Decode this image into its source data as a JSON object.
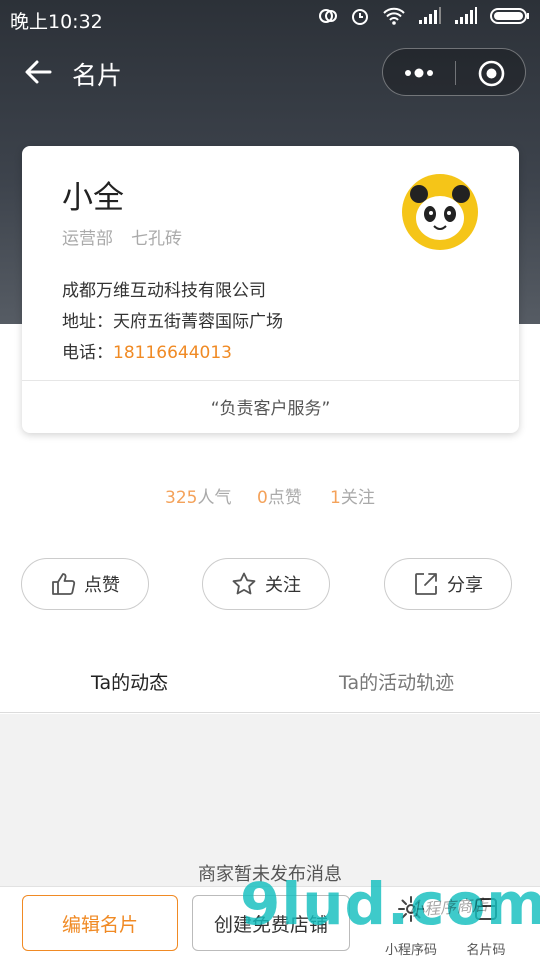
{
  "status_bar": {
    "time": "晚上10:32"
  },
  "nav": {
    "title": "名片"
  },
  "card": {
    "name": "小全",
    "department": "运营部",
    "job_title": "七孔砖",
    "company": "成都万维互动科技有限公司",
    "address_label": "地址：",
    "address": "天府五街菁蓉国际广场",
    "phone_label": "电话：",
    "phone": "18116644013",
    "motto": "“负责客户服务”"
  },
  "stats": {
    "popularity_num": "325",
    "popularity_label": "人气",
    "likes_num": "0",
    "likes_label": "点赞",
    "follows_num": "1",
    "follows_label": "关注"
  },
  "actions": {
    "like": "点赞",
    "follow": "关注",
    "share": "分享"
  },
  "tabs": {
    "posts": "Ta的动态",
    "activity": "Ta的活动轨迹",
    "active": "posts"
  },
  "feed": {
    "empty_message": "商家暂未发布消息"
  },
  "bottom_bar": {
    "edit_card": "编辑名片",
    "create_shop": "创建免费店铺",
    "mini_program_code": "小程序码",
    "card_code": "名片码"
  },
  "watermark": {
    "logo": "9lud.com",
    "script": "小程序商店"
  },
  "colors": {
    "accent": "#f08a24",
    "stat_number": "#f4a25a",
    "header_dark": "#2c3138"
  },
  "icons": [
    "back-arrow-icon",
    "more-dots-icon",
    "target-icon",
    "thumbs-up-icon",
    "star-icon",
    "share-icon",
    "mini-program-code-icon",
    "card-code-icon"
  ]
}
